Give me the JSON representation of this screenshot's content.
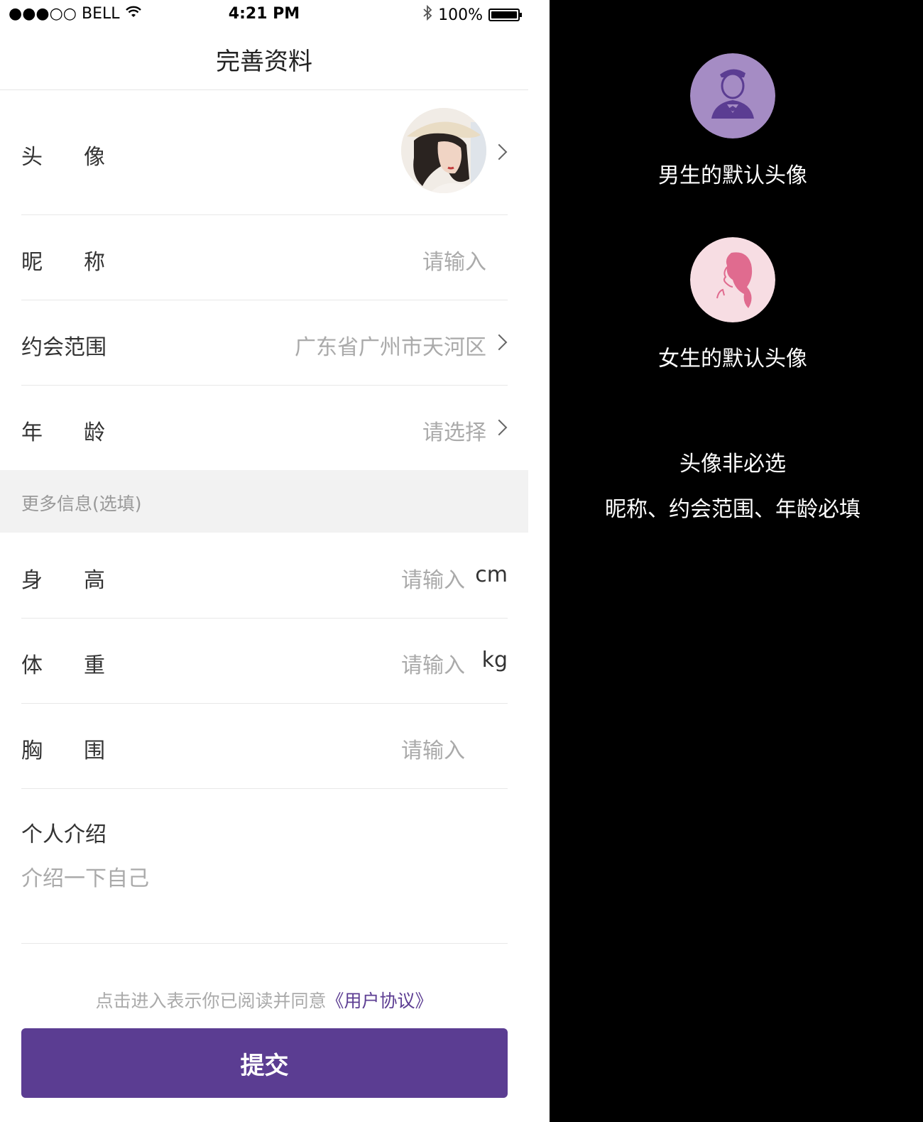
{
  "status_bar": {
    "carrier": "●●●○○ BELL",
    "time": "4:21 PM",
    "battery_text": "100%",
    "battery_level": 1.0
  },
  "nav": {
    "title": "完善资料"
  },
  "form": {
    "avatar_label": "头像",
    "nickname": {
      "label": "昵称",
      "placeholder": "请输入"
    },
    "date_range": {
      "label": "约会范围",
      "value": "广东省广州市天河区"
    },
    "age": {
      "label": "年龄",
      "placeholder": "请选择"
    },
    "more_info_header": "更多信息(选填)",
    "height": {
      "label": "身高",
      "placeholder": "请输入",
      "unit": "cm"
    },
    "weight": {
      "label": "体重",
      "placeholder": "请输入",
      "unit": "kg"
    },
    "chest": {
      "label": "胸围",
      "placeholder": "请输入"
    },
    "intro": {
      "label": "个人介绍",
      "placeholder": "介绍一下自己"
    }
  },
  "footer": {
    "agreement_text": "点击进入表示你已阅读并同意",
    "agreement_link": "《用户协议》",
    "submit_label": "提交"
  },
  "annotations": {
    "male_caption": "男生的默认头像",
    "female_caption": "女生的默认头像",
    "note_line1": "头像非必选",
    "note_line2": "昵称、约会范围、年龄必填"
  },
  "colors": {
    "accent": "#5b3d92",
    "male_bg": "#a58cc4",
    "female_bg": "#f7dde3",
    "female_fg": "#e06b8f"
  }
}
